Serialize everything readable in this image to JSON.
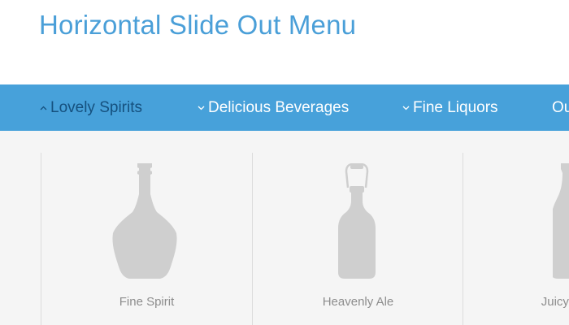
{
  "page": {
    "title": "Horizontal Slide Out Menu"
  },
  "colors": {
    "title": "#4a9fd8",
    "navbar": "#47a1da",
    "nav_text": "#ffffff",
    "nav_active_text": "#15507e",
    "submenu_bg": "#f5f5f5",
    "bottle": "#cfcfcf",
    "product_label": "#8d8d8d"
  },
  "nav": {
    "items": [
      {
        "label": "Lovely Spirits",
        "icon": "chevron-up-icon",
        "active": true
      },
      {
        "label": "Delicious Beverages",
        "icon": "chevron-down-icon",
        "active": false
      },
      {
        "label": "Fine Liquors",
        "icon": "chevron-down-icon",
        "active": false
      },
      {
        "label": "Ou",
        "icon": "none",
        "active": false
      }
    ]
  },
  "submenu": {
    "products": [
      {
        "label": "Fine Spirit",
        "icon": "spirit-bottle-icon"
      },
      {
        "label": "Heavenly Ale",
        "icon": "ale-bottle-icon"
      },
      {
        "label": "Juicy Lem",
        "icon": "lemonade-bottle-icon"
      }
    ]
  }
}
